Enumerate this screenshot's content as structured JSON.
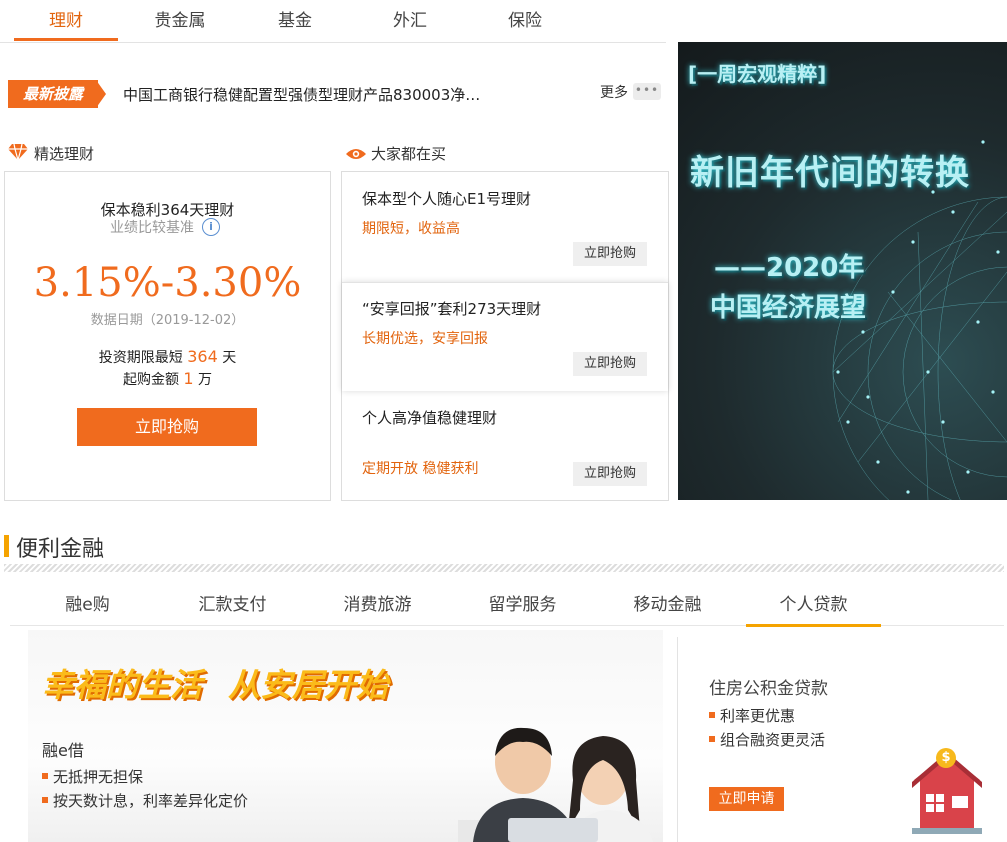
{
  "top_tabs": [
    "理财",
    "贵金属",
    "基金",
    "外汇",
    "保险"
  ],
  "disclosure": {
    "badge": "最新披露",
    "text": "中国工商银行稳健配置型强债型理财产品830003净…",
    "more": "更多",
    "dots": "•••"
  },
  "featured": {
    "heading": "精选理财",
    "name": "保本稳利364天理财",
    "benchmark_label": "业绩比较基准",
    "info_glyph": "i",
    "rate": "3.15%-3.30%",
    "data_date": "数据日期（2019-12-02）",
    "term_prefix": "投资期限最短",
    "term_value": "364",
    "term_unit": "天",
    "min_prefix": "起购金额",
    "min_value": "1",
    "min_unit": "万",
    "buy_label": "立即抢购"
  },
  "popular": {
    "heading": "大家都在买",
    "items": [
      {
        "title": "保本型个人随心E1号理财",
        "tag": "期限短，收益高",
        "button": "立即抢购"
      },
      {
        "title": "“安享回报”套利273天理财",
        "tag": "长期优选，安享回报",
        "button": "立即抢购"
      },
      {
        "title": "个人高净值稳健理财",
        "tag": "定期开放 稳健获利",
        "button": "立即抢购"
      }
    ]
  },
  "banner": {
    "tag": "[一周宏观精粹]",
    "headline": "新旧年代间的转换",
    "line1": "——2020年",
    "line2": "中国经济展望"
  },
  "convenience": {
    "title": "便利金融",
    "tabs": [
      "融e购",
      "汇款支付",
      "消费旅游",
      "留学服务",
      "移动金融",
      "个人贷款"
    ],
    "active_tab": "个人贷款",
    "promo": {
      "slogan_left": "幸福的生活",
      "slogan_right": "从安居开始",
      "product": "融e借",
      "points": [
        "无抵押无担保",
        "按天数计息，利率差异化定价"
      ]
    },
    "side": {
      "title": "住房公积金贷款",
      "points": [
        "利率更优惠",
        "组合融资更灵活"
      ],
      "button": "立即申请",
      "icon_glyph": "$"
    }
  },
  "colors": {
    "accent": "#f06b1e",
    "gold": "#f5a300",
    "banner_text": "#b8f0f4"
  }
}
